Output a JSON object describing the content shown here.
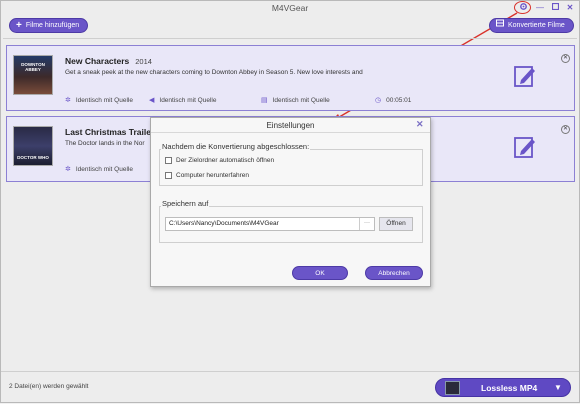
{
  "app": {
    "title": "M4VGear"
  },
  "toolbar": {
    "add_label": "Filme hinzufügen",
    "converted_label": "Konvertierte Filme"
  },
  "movies": [
    {
      "title": "New Characters",
      "year": "2014",
      "thumb_text": "DOWNTON ABBEY",
      "description": "Get a sneak peek at the new characters coming to Downton Abbey in Season 5. New love interests and",
      "video": "Identisch mit Quelle",
      "audio": "Identisch mit Quelle",
      "subtitle": "Identisch mit Quelle",
      "duration": "00:05:01"
    },
    {
      "title": "Last Christmas Trailer",
      "year": "",
      "thumb_text": "DOCTOR WHO",
      "description": "The Doctor lands in the Nor",
      "video": "Identisch mit Quelle"
    }
  ],
  "dialog": {
    "title": "Einstellungen",
    "group1_title": "Nachdem die Konvertierung abgeschlossen:",
    "opt_open_folder": "Der Zielordner automatisch öffnen",
    "opt_shutdown": "Computer herunterfahren",
    "group2_title": "Speichern auf",
    "path": "C:\\Users\\Nancy\\Documents\\M4VGear",
    "dots": "···",
    "open_label": "Öffnen",
    "ok_label": "OK",
    "cancel_label": "Abbrechen"
  },
  "footer": {
    "status": "2 Datei(en) werden gewählt",
    "format_label": "Lossless MP4"
  },
  "colors": {
    "accent": "#6a55c8",
    "card_bg": "#e9e7f8",
    "highlight": "#d9322b"
  }
}
